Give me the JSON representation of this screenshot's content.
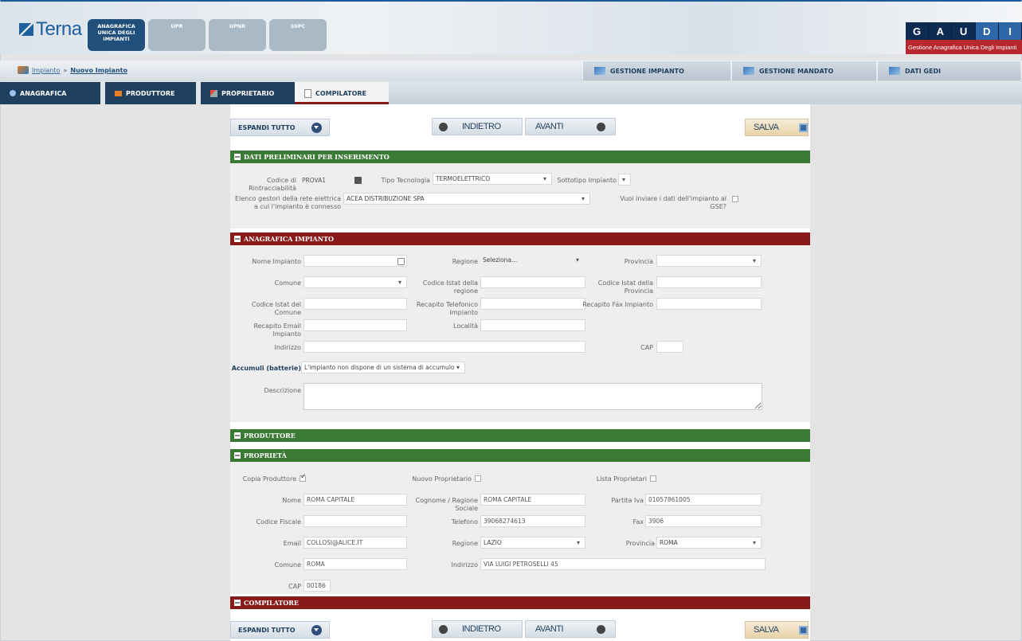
{
  "header": {
    "logo_text": "Terna",
    "top_tabs": [
      {
        "label": "ANAGRAFICA UNICA DEGLI IMPIANTI",
        "active": true
      },
      {
        "label": "UPR",
        "active": false
      },
      {
        "label": "UPNR",
        "active": false
      },
      {
        "label": "SSPC",
        "active": false
      }
    ],
    "gaudi_letters": [
      "G",
      "A",
      "U",
      "D",
      "I"
    ],
    "gaudi_subtitle": "Gestione Anagrafica Unica Degli Impianti"
  },
  "breadcrumb": {
    "root": "Impianto",
    "sep": "»",
    "current": "Nuovo Impianto"
  },
  "nav_buttons": [
    "GESTIONE IMPIANTO",
    "GESTIONE MANDATO",
    "DATI GEDI"
  ],
  "section_tabs": [
    "ANAGRAFICA",
    "PRODUTTORE",
    "PROPRIETARIO",
    "COMPILATORE"
  ],
  "toolbar": {
    "expand_all": "ESPANDI TUTTO",
    "back": "INDIETRO",
    "next": "AVANTI",
    "save": "SALVA"
  },
  "dati_preliminari": {
    "title": "DATI PRELIMINARI PER INSERIMENTO",
    "codice_label": "Codice di Rintracciabilità",
    "codice_value": "PROVA1",
    "tipo_label": "Tipo Tecnologia",
    "tipo_value": "TERMOELETTRICO",
    "sottotipo_label": "Sottotipo Impianto",
    "gestori_label": "Elenco gestori della rete elettrica a cui l'impianto è connesso",
    "gestori_value": "ACEA DISTRIBUZIONE SPA",
    "gse_label": "Vuoi inviare i dati dell'impianto al GSE?"
  },
  "anagrafica": {
    "title": "ANAGRAFICA IMPIANTO",
    "nome_label": "Nome Impianto",
    "regione_label": "Regione",
    "regione_value": "Seleziona...",
    "provincia_label": "Provincia",
    "comune_label": "Comune",
    "istat_regione_label": "Codice Istat della regione",
    "istat_provincia_label": "Codice Istat della Provincia",
    "istat_comune_label": "Codice Istat del Comune",
    "tel_label": "Recapito Telefonico Impianto",
    "fax_label": "Recapito Fax Impianto",
    "email_label": "Recapito Email Impianto",
    "localita_label": "Località",
    "indirizzo_label": "Indirizzo",
    "cap_label": "CAP",
    "accumuli_label": "Accumuli (batterie)",
    "accumuli_value": "L'impianto non dispone di un sistema di accumulo",
    "descrizione_label": "Descrizione"
  },
  "produttore": {
    "title": "PRODUTTORE"
  },
  "proprieta": {
    "title": "PROPRIETÀ",
    "copia_label": "Copia Produttore",
    "nuovo_label": "Nuovo Proprietario",
    "lista_label": "Lista Proprietari",
    "nome_label": "Nome",
    "nome_value": "ROMA CAPITALE",
    "cognome_label": "Cognome / Ragione Sociale",
    "cognome_value": "ROMA CAPITALE",
    "piva_label": "Partita Iva",
    "piva_value": "01057861005",
    "cf_label": "Codice Fiscale",
    "telefono_label": "Telefono",
    "telefono_value": "39068274613",
    "fax_label": "Fax",
    "fax_value": "3906",
    "email_label": "Email",
    "email_value": "COLLOSI@ALICE.IT",
    "regione_label": "Regione",
    "regione_value": "LAZIO",
    "provincia_label": "Provincia",
    "provincia_value": "ROMA",
    "comune_label": "Comune",
    "comune_value": "ROMA",
    "indirizzo_label": "Indirizzo",
    "indirizzo_value": "VIA LUIGI PETROSELLI 45",
    "cap_label": "CAP",
    "cap_value": "00186"
  },
  "compilatore": {
    "title": "COMPILATORE"
  }
}
